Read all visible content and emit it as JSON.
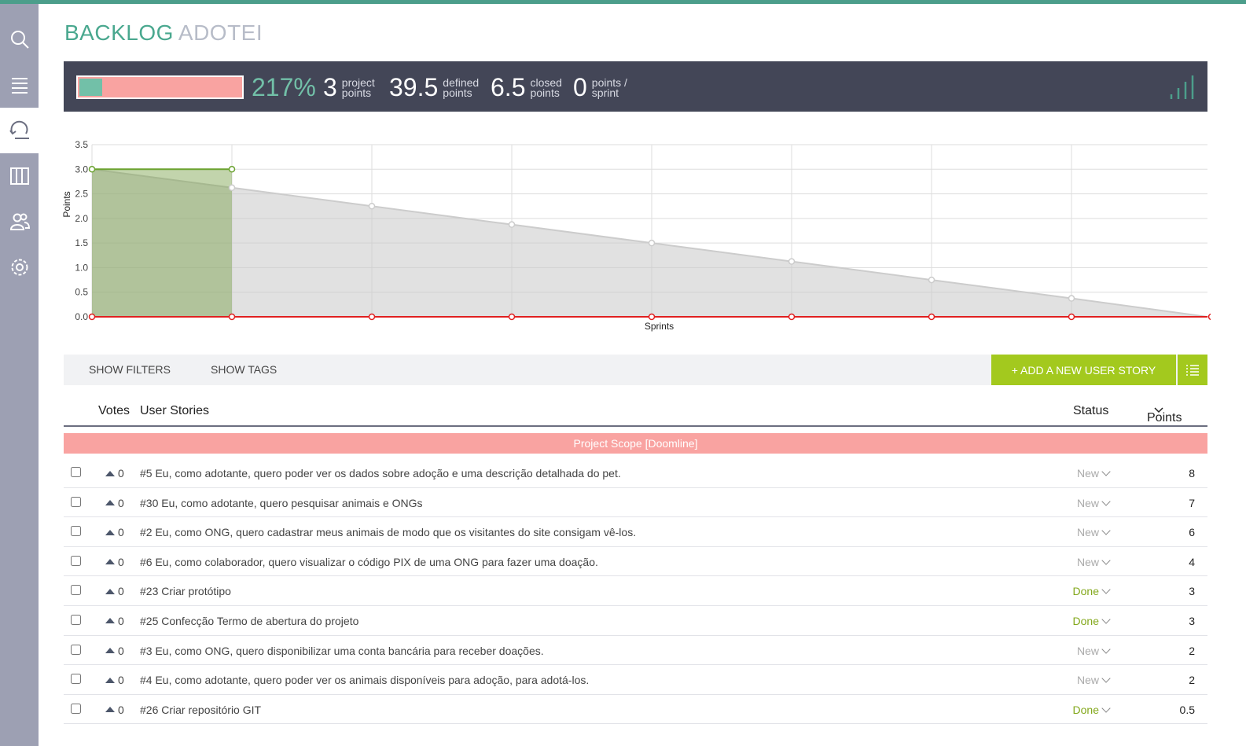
{
  "page": {
    "title_primary": "BACKLOG",
    "title_secondary": "ADOTEI"
  },
  "sidebar": {
    "items": [
      {
        "name": "search-icon",
        "label": "Search"
      },
      {
        "name": "backlog-icon",
        "label": "Backlog"
      },
      {
        "name": "sprint-icon",
        "label": "Sprint",
        "active": true
      },
      {
        "name": "kanban-icon",
        "label": "Kanban"
      },
      {
        "name": "team-icon",
        "label": "Team"
      },
      {
        "name": "settings-icon",
        "label": "Settings"
      }
    ]
  },
  "summary": {
    "progress_fraction": 0.14,
    "percent": "217%",
    "project_points": "3",
    "project_points_label_1": "project",
    "project_points_label_2": "points",
    "defined_points": "39.5",
    "defined_label_1": "defined",
    "defined_label_2": "points",
    "closed_points": "6.5",
    "closed_label_1": "closed",
    "closed_label_2": "points",
    "points_per_sprint": "0",
    "pps_label_1": "points /",
    "pps_label_2": "sprint",
    "colors": {
      "progress_fill": "#72c0a8",
      "progress_bg": "#f9a3a1",
      "bar_bg": "#434657"
    }
  },
  "chart_data": {
    "type": "area",
    "title": "",
    "xlabel": "Sprints",
    "ylabel": "Points",
    "ylim": [
      0,
      3.5
    ],
    "yticks": [
      "0.0",
      "0.5",
      "1.0",
      "1.5",
      "2.0",
      "2.5",
      "3.0",
      "3.5"
    ],
    "x_count": 9,
    "grid": true,
    "series": [
      {
        "key": "optimal",
        "color": "#cccccc",
        "values": [
          3.0,
          2.625,
          2.25,
          1.875,
          1.5,
          1.125,
          0.75,
          0.375,
          0.0
        ]
      },
      {
        "key": "real",
        "color": "#6aa22f",
        "values": [
          3.0,
          3.0
        ]
      },
      {
        "key": "client_increment",
        "color": "#e02020",
        "values": [
          0,
          0,
          0,
          0,
          0,
          0,
          0,
          0,
          0
        ]
      }
    ]
  },
  "filters": {
    "show_filters": "SHOW FILTERS",
    "show_tags": "SHOW TAGS",
    "add_story": "+ ADD A NEW USER STORY"
  },
  "table": {
    "col_votes": "Votes",
    "col_stories": "User Stories",
    "col_status": "Status",
    "col_points": "Points",
    "doomline": "Project Scope [Doomline]",
    "rows": [
      {
        "votes": "0",
        "subject": "#5 Eu, como adotante, quero poder ver os dados sobre adoção e uma descrição detalhada do pet.",
        "status": "New",
        "points": "8"
      },
      {
        "votes": "0",
        "subject": "#30 Eu, como adotante, quero pesquisar animais e ONGs",
        "status": "New",
        "points": "7"
      },
      {
        "votes": "0",
        "subject": "#2 Eu, como ONG, quero cadastrar meus animais de modo que os visitantes do site consigam vê-los.",
        "status": "New",
        "points": "6"
      },
      {
        "votes": "0",
        "subject": "#6 Eu, como colaborador, quero visualizar o código PIX de uma ONG para fazer uma doação.",
        "status": "New",
        "points": "4"
      },
      {
        "votes": "0",
        "subject": "#23 Criar protótipo",
        "status": "Done",
        "points": "3"
      },
      {
        "votes": "0",
        "subject": "#25 Confecção Termo de abertura do projeto",
        "status": "Done",
        "points": "3"
      },
      {
        "votes": "0",
        "subject": "#3 Eu, como ONG, quero disponibilizar uma conta bancária para receber doações.",
        "status": "New",
        "points": "2"
      },
      {
        "votes": "0",
        "subject": "#4 Eu, como adotante, quero poder ver os animais disponíveis para adoção, para adotá-los.",
        "status": "New",
        "points": "2"
      },
      {
        "votes": "0",
        "subject": "#26 Criar repositório GIT",
        "status": "Done",
        "points": "0.5"
      }
    ]
  }
}
